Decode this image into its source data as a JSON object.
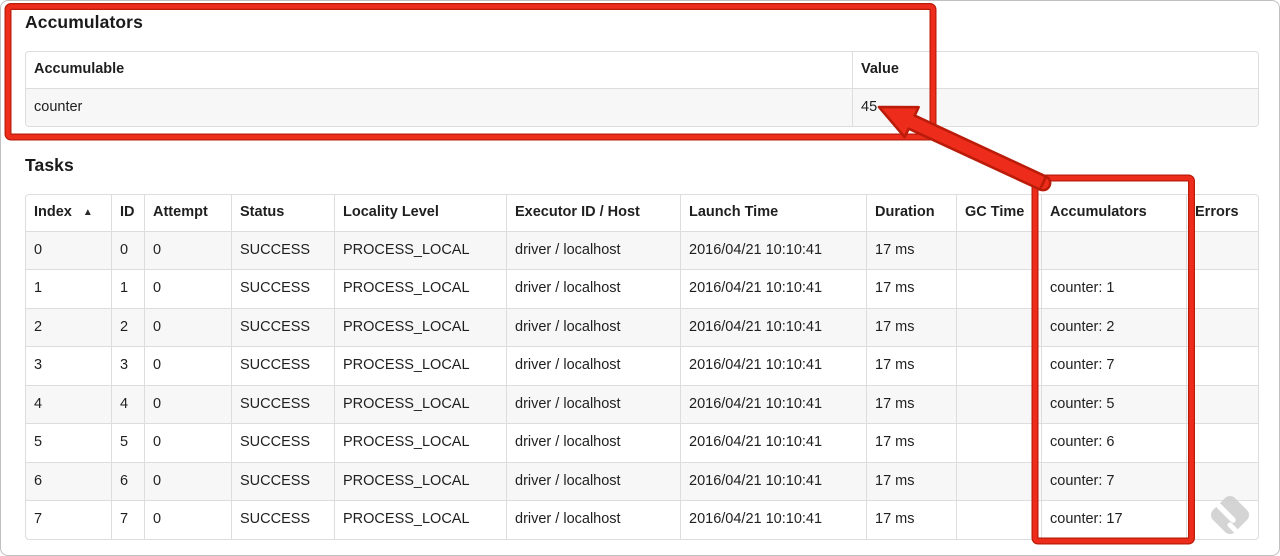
{
  "annotations": {
    "color": "#ed2c1b",
    "outline_color": "#bb1c0a",
    "arrow_icon": "arrow-to-accumulator-value",
    "box_1": "accumulators-section-highlight-box",
    "box_2": "accumulators-column-highlight-box",
    "watermark_icon": "skitch-diamond-watermark-icon",
    "watermark_color": "#d0d0d0"
  },
  "accumulators_section": {
    "title": "Accumulators",
    "table": {
      "headers": [
        "Accumulable",
        "Value"
      ],
      "rows": [
        [
          "counter",
          "45"
        ]
      ]
    }
  },
  "tasks_section": {
    "title": "Tasks",
    "table": {
      "headers": [
        "Index",
        "ID",
        "Attempt",
        "Status",
        "Locality Level",
        "Executor ID / Host",
        "Launch Time",
        "Duration",
        "GC Time",
        "Accumulators",
        "Errors"
      ],
      "sort": {
        "column_index": 0,
        "indicator": "▲",
        "direction": "ascending"
      },
      "rows": [
        [
          "0",
          "0",
          "0",
          "SUCCESS",
          "PROCESS_LOCAL",
          "driver / localhost",
          "2016/04/21 10:10:41",
          "17 ms",
          "",
          "",
          ""
        ],
        [
          "1",
          "1",
          "0",
          "SUCCESS",
          "PROCESS_LOCAL",
          "driver / localhost",
          "2016/04/21 10:10:41",
          "17 ms",
          "",
          "counter: 1",
          ""
        ],
        [
          "2",
          "2",
          "0",
          "SUCCESS",
          "PROCESS_LOCAL",
          "driver / localhost",
          "2016/04/21 10:10:41",
          "17 ms",
          "",
          "counter: 2",
          ""
        ],
        [
          "3",
          "3",
          "0",
          "SUCCESS",
          "PROCESS_LOCAL",
          "driver / localhost",
          "2016/04/21 10:10:41",
          "17 ms",
          "",
          "counter: 7",
          ""
        ],
        [
          "4",
          "4",
          "0",
          "SUCCESS",
          "PROCESS_LOCAL",
          "driver / localhost",
          "2016/04/21 10:10:41",
          "17 ms",
          "",
          "counter: 5",
          ""
        ],
        [
          "5",
          "5",
          "0",
          "SUCCESS",
          "PROCESS_LOCAL",
          "driver / localhost",
          "2016/04/21 10:10:41",
          "17 ms",
          "",
          "counter: 6",
          ""
        ],
        [
          "6",
          "6",
          "0",
          "SUCCESS",
          "PROCESS_LOCAL",
          "driver / localhost",
          "2016/04/21 10:10:41",
          "17 ms",
          "",
          "counter: 7",
          ""
        ],
        [
          "7",
          "7",
          "0",
          "SUCCESS",
          "PROCESS_LOCAL",
          "driver / localhost",
          "2016/04/21 10:10:41",
          "17 ms",
          "",
          "counter: 17",
          ""
        ]
      ]
    }
  }
}
